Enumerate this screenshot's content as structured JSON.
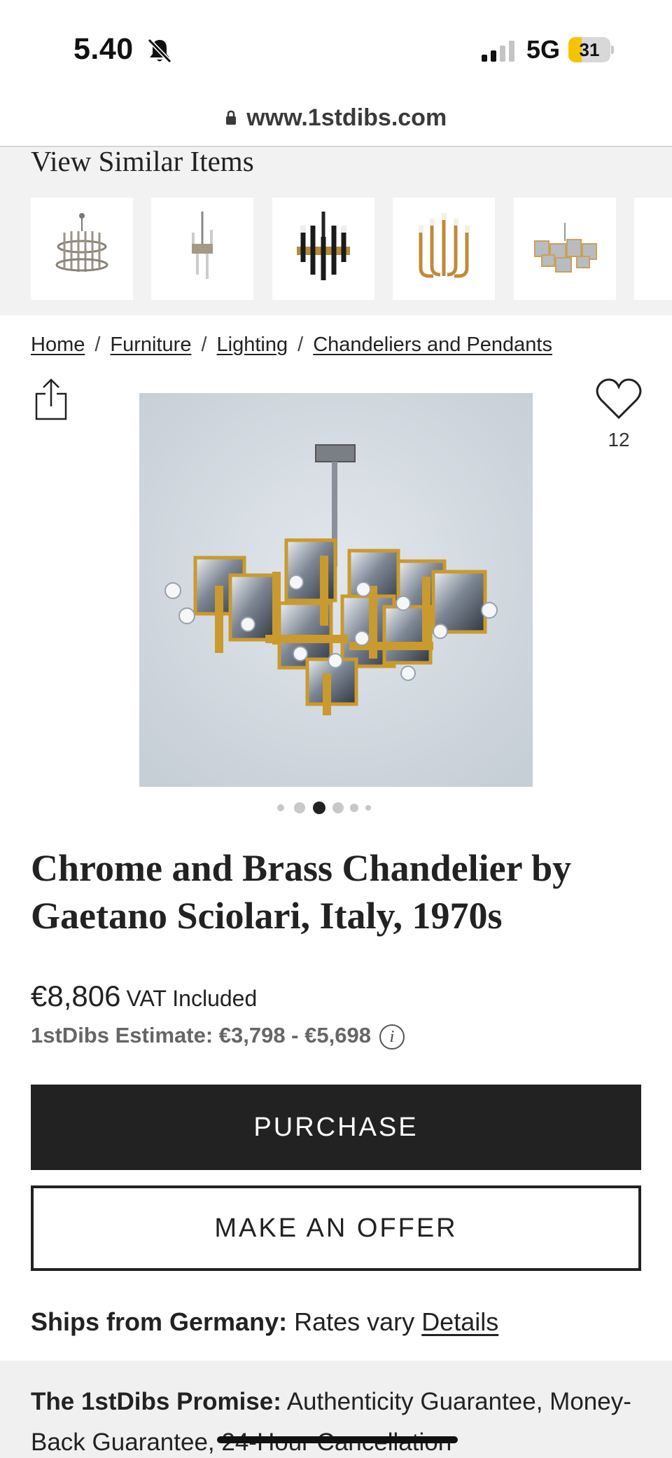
{
  "status_bar": {
    "time": "5.40",
    "network": "5G",
    "battery_level": "31",
    "battery_fraction": 0.31
  },
  "browser": {
    "url": "www.1stdibs.com"
  },
  "similar_items": {
    "title": "View Similar Items"
  },
  "breadcrumb": [
    "Home",
    "Furniture",
    "Lighting",
    "Chandeliers and Pendants"
  ],
  "product": {
    "favorite_count": "12",
    "image_count": 6,
    "active_image_index": 2,
    "title": "Chrome and Brass Chandelier by Gaetano Sciolari, Italy, 1970s",
    "price": "€8,806",
    "vat_note": "VAT Included",
    "estimate": "1stDibs Estimate: €3,798 - €5,698",
    "info_symbol": "i"
  },
  "actions": {
    "purchase_label": "PURCHASE",
    "offer_label": "MAKE AN OFFER"
  },
  "shipping": {
    "label": "Ships from Germany:",
    "text": "Rates vary",
    "link": "Details"
  },
  "promise": {
    "label": "The 1stDibs Promise:",
    "text": "Authenticity Guarantee, Money-Back Guarantee, 24-Hour Cancellation"
  },
  "icons": {
    "bell": "bell-slash-icon",
    "lock": "lock-icon",
    "share": "share-icon",
    "favorite": "heart-icon",
    "info": "info-icon"
  }
}
